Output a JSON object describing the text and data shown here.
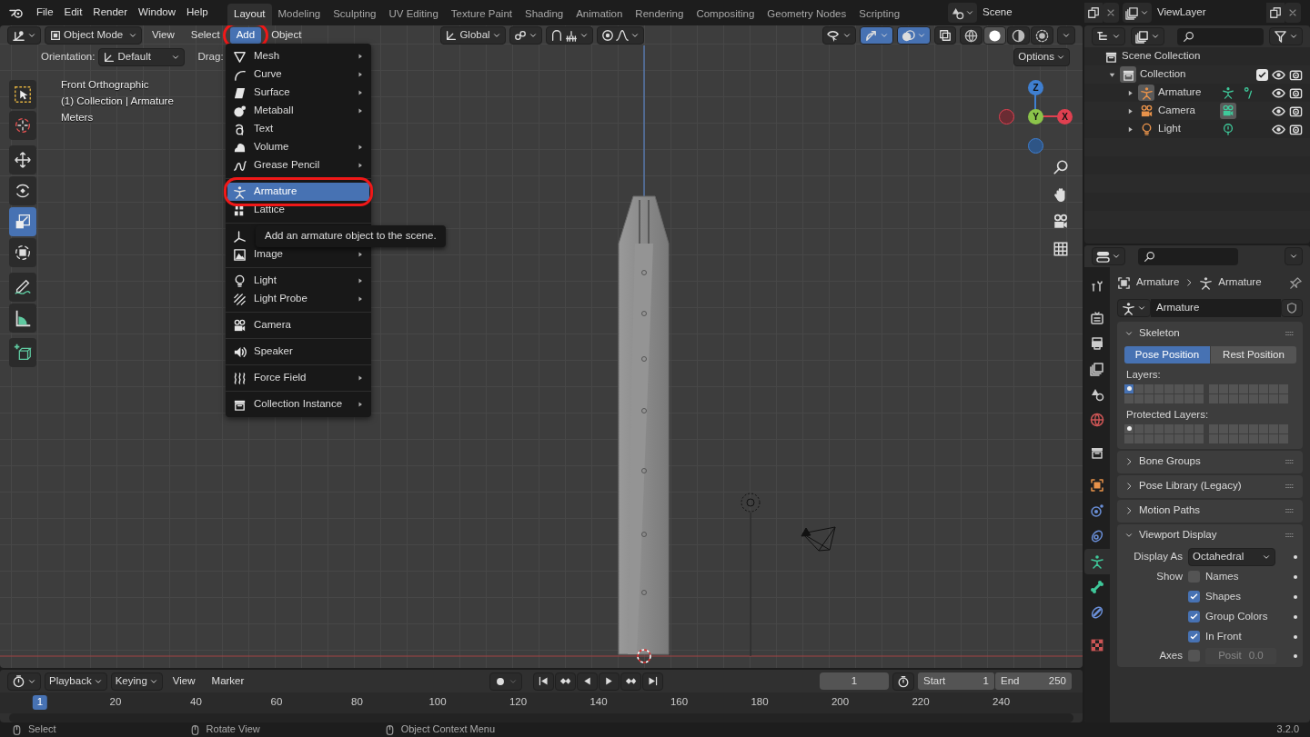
{
  "topbar": {
    "menus": [
      "File",
      "Edit",
      "Render",
      "Window",
      "Help"
    ],
    "workspaces": [
      {
        "label": "Layout",
        "selected": true
      },
      {
        "label": "Modeling",
        "selected": false
      },
      {
        "label": "Sculpting",
        "selected": false
      },
      {
        "label": "UV Editing",
        "selected": false
      },
      {
        "label": "Texture Paint",
        "selected": false
      },
      {
        "label": "Shading",
        "selected": false
      },
      {
        "label": "Animation",
        "selected": false
      },
      {
        "label": "Rendering",
        "selected": false
      },
      {
        "label": "Compositing",
        "selected": false
      },
      {
        "label": "Geometry Nodes",
        "selected": false
      },
      {
        "label": "Scripting",
        "selected": false
      }
    ],
    "scene": "Scene",
    "view_layer": "ViewLayer"
  },
  "viewport": {
    "header": {
      "mode": "Object Mode",
      "orientation": "Global",
      "snap": false,
      "proportional": false,
      "gizmos": true,
      "overlays": true,
      "menus": [
        {
          "label": "View",
          "selected": false,
          "annotated": false
        },
        {
          "label": "Select",
          "selected": false,
          "annotated": false
        },
        {
          "label": "Add",
          "selected": true,
          "annotated": true
        },
        {
          "label": "Object",
          "selected": false,
          "annotated": false
        }
      ],
      "shading": [
        {
          "selected": false
        },
        {
          "selected": true
        },
        {
          "selected": false
        },
        {
          "selected": false
        }
      ]
    },
    "tool_settings": {
      "orientation_label": "Orientation:",
      "orientation": "Default",
      "drag_label": "Drag:",
      "options": "Options"
    },
    "info": [
      "Front Orthographic",
      "(1) Collection | Armature",
      "Meters"
    ],
    "tools": [
      {
        "selected": false
      },
      {
        "selected": false
      },
      {
        "selected": false
      },
      {
        "selected": false
      },
      {
        "selected": true
      },
      {
        "selected": false
      },
      {
        "selected": false
      },
      {
        "selected": false
      },
      {
        "selected": false
      }
    ],
    "gizmo": {
      "x": "X",
      "y": "Y",
      "z": "Z"
    },
    "add_menu": {
      "groups": [
        [
          {
            "label": "Mesh",
            "has_submenu": true,
            "selected": false,
            "annotated": false
          },
          {
            "label": "Curve",
            "has_submenu": true,
            "selected": false,
            "annotated": false
          },
          {
            "label": "Surface",
            "has_submenu": true,
            "selected": false,
            "annotated": false
          },
          {
            "label": "Metaball",
            "has_submenu": true,
            "selected": false,
            "annotated": false
          },
          {
            "label": "Text",
            "has_submenu": false,
            "selected": false,
            "annotated": false
          },
          {
            "label": "Volume",
            "has_submenu": true,
            "selected": false,
            "annotated": false
          },
          {
            "label": "Grease Pencil",
            "has_submenu": true,
            "selected": false,
            "annotated": false
          }
        ],
        [
          {
            "label": "Armature",
            "has_submenu": false,
            "selected": true,
            "annotated": true
          },
          {
            "label": "Lattice",
            "has_submenu": false,
            "selected": false,
            "annotated": false
          }
        ],
        [
          {
            "has_submenu": false,
            "selected": false,
            "annotated": false
          },
          {
            "label": "Image",
            "has_submenu": true,
            "selected": false,
            "annotated": false
          }
        ],
        [
          {
            "label": "Light",
            "has_submenu": true,
            "selected": false,
            "annotated": false
          },
          {
            "label": "Light Probe",
            "has_submenu": true,
            "selected": false,
            "annotated": false
          }
        ],
        [
          {
            "label": "Camera",
            "has_submenu": false,
            "selected": false,
            "annotated": false
          }
        ],
        [
          {
            "label": "Speaker",
            "has_submenu": false,
            "selected": false,
            "annotated": false
          }
        ],
        [
          {
            "label": "Force Field",
            "has_submenu": true,
            "selected": false,
            "annotated": false
          }
        ],
        [
          {
            "label": "Collection Instance",
            "has_submenu": true,
            "selected": false,
            "annotated": false
          }
        ]
      ]
    },
    "tooltip": "Add an armature object to the scene."
  },
  "outliner": {
    "tree": [
      {
        "label": "Scene Collection",
        "children": [
          {
            "label": "Collection",
            "expanded": true,
            "checked": true,
            "children": [
              {
                "label": "Armature",
                "expanded": false,
                "active": true,
                "data_highlighted": false
              },
              {
                "label": "Camera",
                "expanded": false,
                "active": false,
                "data_highlighted": true
              },
              {
                "label": "Light",
                "expanded": false,
                "active": false,
                "data_highlighted": false
              }
            ]
          }
        ]
      }
    ]
  },
  "properties": {
    "tabs": [
      {
        "selected": false
      },
      {
        "selected": false
      },
      {
        "selected": false
      },
      {
        "selected": false
      },
      {
        "selected": false
      },
      {
        "selected": false
      },
      {
        "selected": false
      },
      {
        "selected": false
      },
      {
        "selected": false
      },
      {
        "selected": false
      },
      {
        "selected": true
      },
      {
        "selected": false
      },
      {
        "selected": false
      },
      {
        "selected": false
      }
    ],
    "breadcrumb": [
      "Armature",
      "Armature"
    ],
    "datablock": "Armature",
    "panels": [
      {
        "label": "Skeleton",
        "expanded": true,
        "kind": "skeleton"
      },
      {
        "label": "Bone Groups",
        "expanded": false,
        "kind": "plain"
      },
      {
        "label": "Pose Library (Legacy)",
        "expanded": false,
        "kind": "plain"
      },
      {
        "label": "Motion Paths",
        "expanded": false,
        "kind": "plain"
      },
      {
        "label": "Viewport Display",
        "expanded": true,
        "kind": "display"
      }
    ],
    "skeleton": {
      "positions": [
        {
          "label": "Pose Position",
          "selected": true
        },
        {
          "label": "Rest Position",
          "selected": false
        }
      ],
      "layers_label": "Layers:",
      "layers_visible": [
        true,
        false,
        false,
        false,
        false,
        false,
        false,
        false,
        false,
        false,
        false,
        false,
        false,
        false,
        false,
        false,
        false,
        false,
        false,
        false,
        false,
        false,
        false,
        false,
        false,
        false,
        false,
        false,
        false,
        false,
        false,
        false
      ],
      "layers_used": [
        true,
        false,
        false,
        false,
        false,
        false,
        false,
        false,
        false,
        false,
        false,
        false,
        false,
        false,
        false,
        false,
        false,
        false,
        false,
        false,
        false,
        false,
        false,
        false,
        false,
        false,
        false,
        false,
        false,
        false,
        false,
        false
      ],
      "protected_label": "Protected Layers:",
      "protected_on": [
        false,
        false,
        false,
        false,
        false,
        false,
        false,
        false,
        false,
        false,
        false,
        false,
        false,
        false,
        false,
        false,
        false,
        false,
        false,
        false,
        false,
        false,
        false,
        false,
        false,
        false,
        false,
        false,
        false,
        false,
        false,
        false
      ],
      "protected_used": [
        true,
        false,
        false,
        false,
        false,
        false,
        false,
        false,
        false,
        false,
        false,
        false,
        false,
        false,
        false,
        false,
        false,
        false,
        false,
        false,
        false,
        false,
        false,
        false,
        false,
        false,
        false,
        false,
        false,
        false,
        false,
        false
      ]
    },
    "display": {
      "display_as_label": "Display As",
      "display_as": "Octahedral",
      "show_label": "Show",
      "options": [
        {
          "label": "Names",
          "checked": false
        },
        {
          "label": "Shapes",
          "checked": true
        },
        {
          "label": "Group Colors",
          "checked": true
        },
        {
          "label": "In Front",
          "checked": true
        }
      ],
      "axes": {
        "label": "Axes",
        "checked": false,
        "field_label": "Posit",
        "field_value": "0.0",
        "disabled": true
      }
    }
  },
  "timeline": {
    "menus": [
      {
        "label": "Playback",
        "dropdown": true
      },
      {
        "label": "Keying",
        "dropdown": true
      },
      {
        "label": "View",
        "dropdown": false
      },
      {
        "label": "Marker",
        "dropdown": false
      }
    ],
    "current_frame": "1",
    "start_label": "Start",
    "start": "1",
    "end_label": "End",
    "end": "250",
    "ruler": [
      {
        "label": "1",
        "selected": true
      },
      {
        "label": "20",
        "selected": false
      },
      {
        "label": "40",
        "selected": false
      },
      {
        "label": "60",
        "selected": false
      },
      {
        "label": "80",
        "selected": false
      },
      {
        "label": "100",
        "selected": false
      },
      {
        "label": "120",
        "selected": false
      },
      {
        "label": "140",
        "selected": false
      },
      {
        "label": "160",
        "selected": false
      },
      {
        "label": "180",
        "selected": false
      },
      {
        "label": "200",
        "selected": false
      },
      {
        "label": "220",
        "selected": false
      },
      {
        "label": "240",
        "selected": false
      }
    ]
  },
  "status_bar": {
    "hints": [
      "Select",
      "Rotate View",
      "Object Context Menu"
    ],
    "version": "3.2.0"
  }
}
